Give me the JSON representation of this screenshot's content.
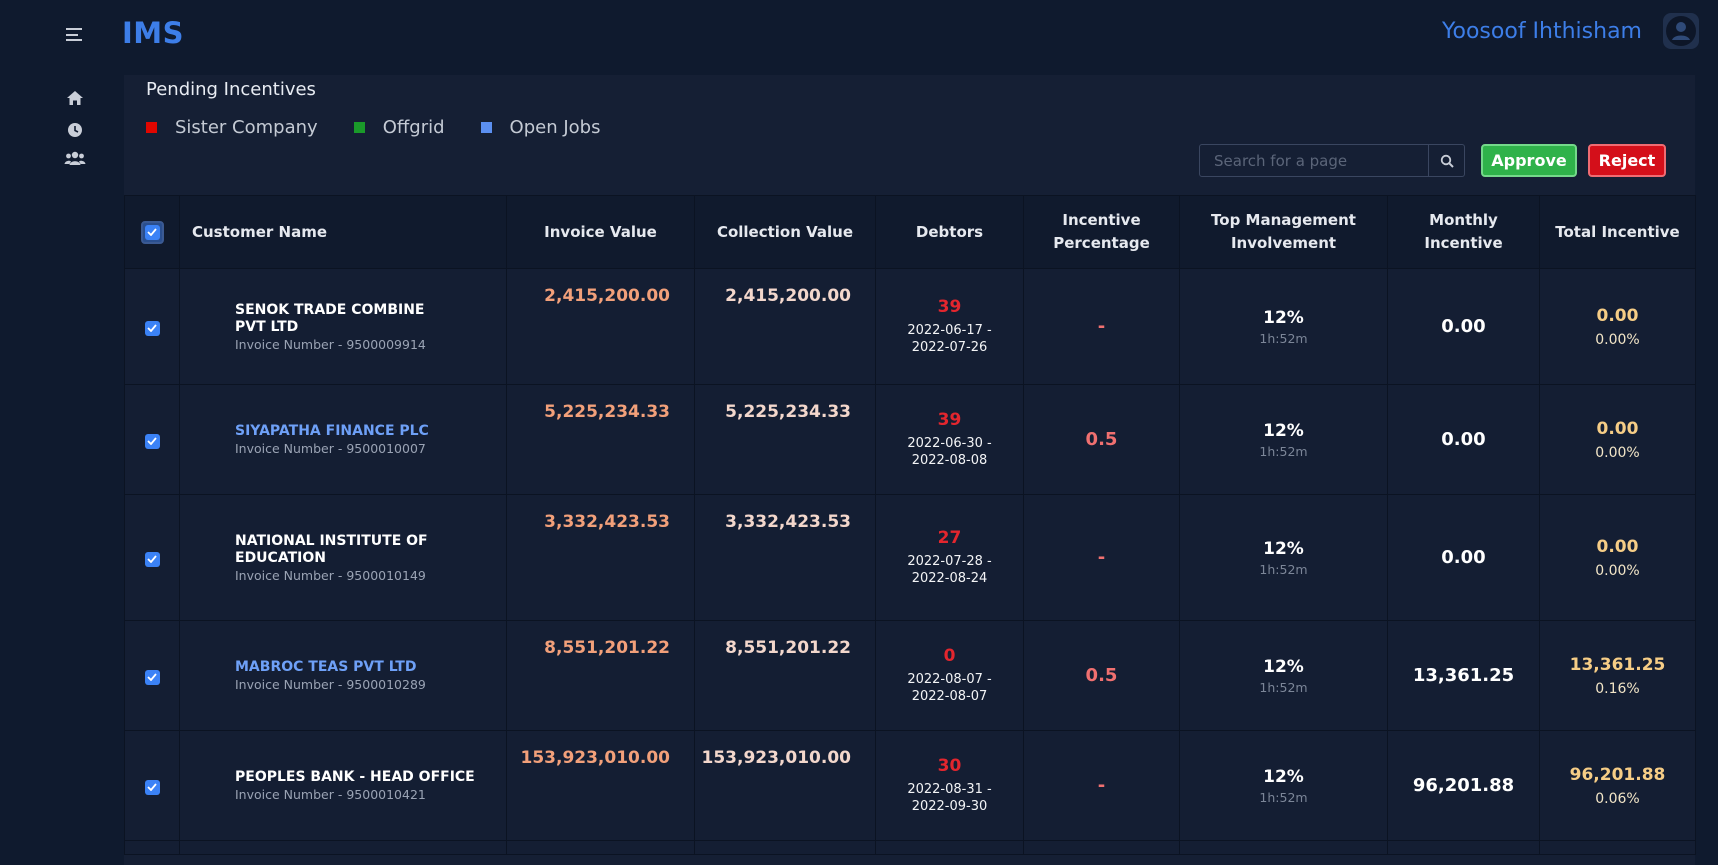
{
  "header": {
    "app_title": "IMS",
    "username": "Yoosoof Ihthisham",
    "brand_color": "#3d7ee8"
  },
  "sidebar": {
    "items": [
      {
        "icon": "home-icon"
      },
      {
        "icon": "clock-icon"
      },
      {
        "icon": "users-icon"
      }
    ]
  },
  "page": {
    "title": "Pending Incentives",
    "legend": [
      {
        "label": "Sister Company",
        "color": "#e10600"
      },
      {
        "label": "Offgrid",
        "color": "#1a9a2a"
      },
      {
        "label": "Open Jobs",
        "color": "#5b8ff0"
      }
    ],
    "search_placeholder": "Search for a page",
    "approve_label": "Approve",
    "reject_label": "Reject"
  },
  "table": {
    "columns": {
      "customer_name": "Customer Name",
      "invoice_value": "Invoice Value",
      "collection_value": "Collection Value",
      "debtors": "Debtors",
      "incentive_percentage": "Incentive Percentage",
      "top_management": "Top Management Involvement",
      "monthly_incentive": "Monthly Incentive",
      "total_incentive": "Total Incentive"
    },
    "rows": [
      {
        "checked": true,
        "customer": "SENOK TRADE COMBINE PVT LTD",
        "highlight": false,
        "invoice_number": "Invoice Number - 9500009914",
        "invoice_value": "2,415,200.00",
        "collection_value": "2,415,200.00",
        "debtors": "39",
        "debtor_dates": "2022-06-17 - 2022-07-26",
        "incentive_pct": "-",
        "tmi_pct": "12%",
        "tmi_time": "1h:52m",
        "monthly": "0.00",
        "total": "0.00",
        "total_pct": "0.00%"
      },
      {
        "checked": true,
        "customer": "SIYAPATHA FINANCE PLC",
        "highlight": true,
        "invoice_number": "Invoice Number - 9500010007",
        "invoice_value": "5,225,234.33",
        "collection_value": "5,225,234.33",
        "debtors": "39",
        "debtor_dates": "2022-06-30 - 2022-08-08",
        "incentive_pct": "0.5",
        "tmi_pct": "12%",
        "tmi_time": "1h:52m",
        "monthly": "0.00",
        "total": "0.00",
        "total_pct": "0.00%"
      },
      {
        "checked": true,
        "customer": "NATIONAL INSTITUTE OF EDUCATION",
        "highlight": false,
        "invoice_number": "Invoice Number - 9500010149",
        "invoice_value": "3,332,423.53",
        "collection_value": "3,332,423.53",
        "debtors": "27",
        "debtor_dates": "2022-07-28 - 2022-08-24",
        "incentive_pct": "-",
        "tmi_pct": "12%",
        "tmi_time": "1h:52m",
        "monthly": "0.00",
        "total": "0.00",
        "total_pct": "0.00%"
      },
      {
        "checked": true,
        "customer": "MABROC TEAS PVT LTD",
        "highlight": true,
        "invoice_number": "Invoice Number - 9500010289",
        "invoice_value": "8,551,201.22",
        "collection_value": "8,551,201.22",
        "debtors": "0",
        "debtor_dates": "2022-08-07 - 2022-08-07",
        "incentive_pct": "0.5",
        "tmi_pct": "12%",
        "tmi_time": "1h:52m",
        "monthly": "13,361.25",
        "total": "13,361.25",
        "total_pct": "0.16%"
      },
      {
        "checked": true,
        "customer": "PEOPLES BANK - HEAD OFFICE",
        "highlight": false,
        "invoice_number": "Invoice Number - 9500010421",
        "invoice_value": "153,923,010.00",
        "collection_value": "153,923,010.00",
        "debtors": "30",
        "debtor_dates": "2022-08-31 - 2022-09-30",
        "incentive_pct": "-",
        "tmi_pct": "12%",
        "tmi_time": "1h:52m",
        "monthly": "96,201.88",
        "total": "96,201.88",
        "total_pct": "0.06%"
      }
    ]
  }
}
